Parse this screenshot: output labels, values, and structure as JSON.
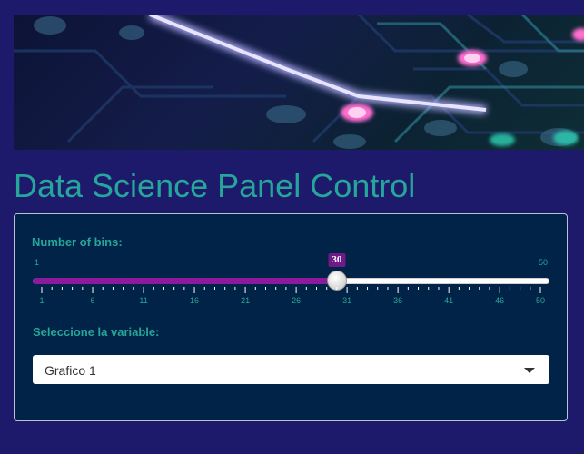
{
  "page": {
    "title": "Data Science Panel Control"
  },
  "banner": {
    "icon": "circuit-board-image"
  },
  "slider": {
    "label": "Number of bins:",
    "min": 1,
    "max": 50,
    "value": 30,
    "min_label": "1",
    "max_label": "50",
    "value_label": "30",
    "tick_labels": [
      "1",
      "6",
      "11",
      "16",
      "21",
      "26",
      "31",
      "36",
      "41",
      "46",
      "50"
    ],
    "fill_color": "#8b1a9c"
  },
  "select": {
    "label": "Seleccione la variable:",
    "value": "Grafico 1",
    "icon": "caret-down-icon"
  },
  "colors": {
    "background": "#1d1a6b",
    "accent": "#26a69a",
    "panel": "#002347"
  }
}
